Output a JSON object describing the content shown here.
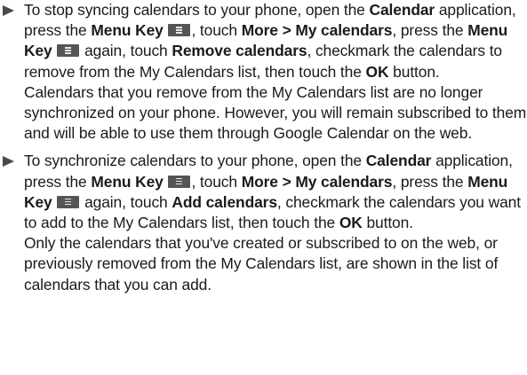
{
  "items": [
    {
      "step": [
        {
          "t": "To stop syncing calendars to your phone, open the "
        },
        {
          "t": "Calendar",
          "b": true
        },
        {
          "t": " application, press the "
        },
        {
          "t": "Menu Key",
          "b": true
        },
        {
          "t": " ",
          "icon": "menu-key-icon"
        },
        {
          "t": ", touch "
        },
        {
          "t": "More > My calendars",
          "b": true
        },
        {
          "t": ", press the "
        },
        {
          "t": "Menu Key",
          "b": true
        },
        {
          "t": " ",
          "icon": "menu-key-icon"
        },
        {
          "t": " again, touch "
        },
        {
          "t": "Remove calendars",
          "b": true
        },
        {
          "t": ", checkmark the calendars to remove from the My Calendars list, then touch the "
        },
        {
          "t": "OK",
          "b": true
        },
        {
          "t": " button."
        }
      ],
      "note": "Calendars that you remove from the My Calendars list are no longer synchronized on your phone. However, you will remain subscribed to them and will be able to use them through Google Calendar on the web."
    },
    {
      "step": [
        {
          "t": "To synchronize calendars to your phone, open the "
        },
        {
          "t": "Calendar",
          "b": true
        },
        {
          "t": " application, press the "
        },
        {
          "t": "Menu Key",
          "b": true
        },
        {
          "t": " ",
          "icon": "menu-key-icon"
        },
        {
          "t": ", touch "
        },
        {
          "t": "More > My calendars",
          "b": true
        },
        {
          "t": ", press the "
        },
        {
          "t": "Menu Key",
          "b": true
        },
        {
          "t": " ",
          "icon": "menu-key-icon"
        },
        {
          "t": " again, touch "
        },
        {
          "t": "Add calendars",
          "b": true
        },
        {
          "t": ", checkmark the calendars you want to add to the My Calendars list, then touch the "
        },
        {
          "t": "OK",
          "b": true
        },
        {
          "t": " button."
        }
      ],
      "note": "Only the calendars that you've created or subscribed to on the web, or previously removed from the My Calendars list, are shown in the list of calendars that you can add."
    }
  ]
}
